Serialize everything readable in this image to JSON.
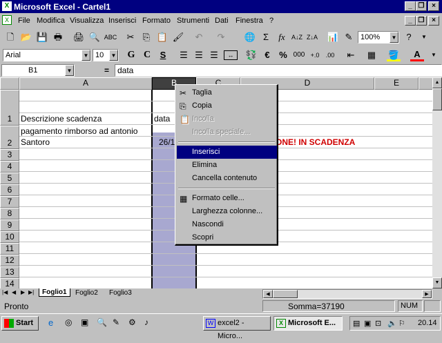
{
  "window": {
    "title": "Microsoft Excel - Cartel1"
  },
  "menu": [
    "File",
    "Modifica",
    "Visualizza",
    "Inserisci",
    "Formato",
    "Strumenti",
    "Dati",
    "Finestra",
    "?"
  ],
  "toolbar": {
    "zoom": "100%",
    "font": "Arial",
    "size": "10",
    "bold": "G",
    "italic": "C",
    "underline": "S",
    "percent": "%",
    "thousands": "000"
  },
  "formula": {
    "namebox": "B1",
    "eq": "=",
    "content": "data"
  },
  "columns": [
    "A",
    "B",
    "C",
    "D",
    "E"
  ],
  "rows": [
    "1",
    "2",
    "3",
    "4",
    "5",
    "6",
    "7",
    "8",
    "9",
    "10",
    "11",
    "12",
    "13",
    "14"
  ],
  "cells": {
    "a1": "Descrizione scadenza",
    "b1": "data",
    "a2_line1": "pagamento rimborso ad antonio",
    "a2_line2": "Santoro",
    "b2": "26/1",
    "d2": "ONE! IN SCADENZA"
  },
  "context_menu": {
    "items": [
      "Taglia",
      "Copia",
      "Incolla",
      "Incolla speciale...",
      "Inserisci",
      "Elimina",
      "Cancella contenuto",
      "Formato celle...",
      "Larghezza colonne...",
      "Nascondi",
      "Scopri"
    ],
    "disabled": [
      2,
      3
    ],
    "selected": 4
  },
  "sheets": [
    "Foglio1",
    "Foglio2",
    "Foglio3"
  ],
  "status": {
    "left": "Pronto",
    "sum": "Somma=37190",
    "num": "NUM"
  },
  "taskbar": {
    "start": "Start",
    "tasks": [
      "excel2 - Micro...",
      "Microsoft E..."
    ],
    "clock": "20.14"
  }
}
